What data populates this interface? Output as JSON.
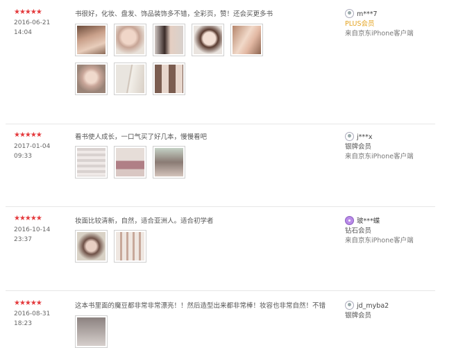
{
  "reviews": [
    {
      "stars": "★★★★★",
      "date": "2016-06-21",
      "time": "14:04",
      "comment": "书很好，化妆、盘发、饰品装饰多不错，全彩页，赞！还会买更多书",
      "user": "m***7",
      "level": "PLUS会员",
      "client": "来自京东iPhone客户端",
      "images": [
        "portrait-photo-1",
        "portrait-photo-2",
        "portrait-photo-3",
        "portrait-photo-4",
        "portrait-photo-5",
        "portrait-photo-6",
        "book-spread-photo",
        "portrait-grid-photo"
      ]
    },
    {
      "stars": "★★★★★",
      "date": "2017-01-04",
      "time": "09:33",
      "comment": "看书使人成长，一口气买了好几本，慢慢看吧",
      "user": "j***x",
      "level": "银牌会员",
      "client": "来自京东iPhone客户端",
      "images": [
        "book-stack-photo",
        "book-cover-photo",
        "book-page-photo"
      ]
    },
    {
      "stars": "★★★★★",
      "date": "2016-10-14",
      "time": "23:37",
      "comment": "妆面比较清新，自然，适合亚洲人。适合初学者",
      "user": "玻***蝶",
      "level": "钻石会员",
      "client": "来自京东iPhone客户端",
      "images": [
        "book-cover-portrait-photo",
        "book-pages-photo"
      ]
    },
    {
      "stars": "★★★★★",
      "date": "2016-08-31",
      "time": "18:23",
      "comment": "这本书里面的魔豆都非常非常漂亮！！然后造型出来都非常棒！妆容也非常自然！不错",
      "user": "jd_myba2",
      "level": "银牌会员",
      "client": "",
      "images": [
        "partial-photo"
      ]
    }
  ],
  "colors": {
    "star": "#e4393c",
    "plus": "#e4a31f",
    "divider": "#e6e6e6"
  }
}
